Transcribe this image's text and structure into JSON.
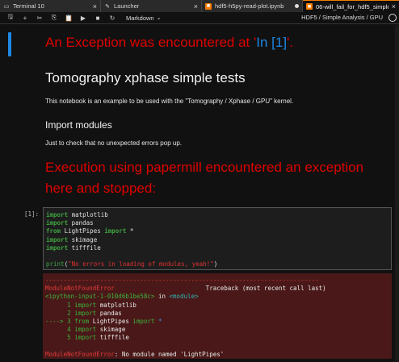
{
  "tabs": [
    {
      "label": "Terminal 10",
      "icon": "terminal-icon"
    },
    {
      "label": "Launcher",
      "icon": "launcher-icon"
    },
    {
      "label": "hdf5-h5py-read-plot.ipynb",
      "icon": "notebook-icon"
    },
    {
      "label": "06-will_fail_for_hdf5_simple",
      "icon": "notebook-icon"
    }
  ],
  "toolbar": {
    "cell_type": "Markdown",
    "kernel": "HDF5 / Simple Analysis / GPU"
  },
  "notebook": {
    "exception_header_prefix": "An Exception was encountered at '",
    "exception_header_link": "In [1]",
    "exception_header_suffix": "'.",
    "title": "Tomography xphase simple tests",
    "intro": "This notebook is an example to be used with the \"Tomography / Xphase / GPU\" kernel.",
    "import_heading": "Import modules",
    "import_text": "Just to check that no unexpected errors pop up.",
    "papermill_line1": "Execution using papermill encountered an exception",
    "papermill_line2": "here and stopped:",
    "prompt": "[1]:",
    "code": {
      "l1_kw": "import",
      "l1_mod": " matplotlib",
      "l2_kw": "import",
      "l2_mod": " pandas",
      "l3_kw1": "from",
      "l3_mod": " LightPipes ",
      "l3_kw2": "import",
      "l3_star": " *",
      "l4_kw": "import",
      "l4_mod": " skimage",
      "l5_kw": "import",
      "l5_mod": " tifffile",
      "l7_fn": "print",
      "l7_open": "(",
      "l7_str": "\"No errors in loading of modules, yeah!\"",
      "l7_close": ")"
    },
    "error": {
      "dashes": "---------------------------------------------------------------------------",
      "name": "ModuleNotFoundError",
      "traceback": "                         Traceback (most recent call last)",
      "input": "<ipython-input-1-010d6b1be58c>",
      "in_text": " in ",
      "module": "<module>",
      "t1_num": "      1 ",
      "t1_kw": "import",
      "t1_mod": " matplotlib",
      "t2_num": "      2 ",
      "t2_kw": "import",
      "t2_mod": " pandas",
      "t3_arrow": "----> 3 ",
      "t3_kw1": "from",
      "t3_mod": " LightPipes ",
      "t3_kw2": "import",
      "t3_star": " *",
      "t4_num": "      4 ",
      "t4_kw": "import",
      "t4_mod": " skimage",
      "t5_num": "      5 ",
      "t5_kw": "import",
      "t5_mod": " tifffile",
      "final_name": "ModuleNotFoundError",
      "final_msg": ": No module named 'LightPipes'"
    }
  }
}
